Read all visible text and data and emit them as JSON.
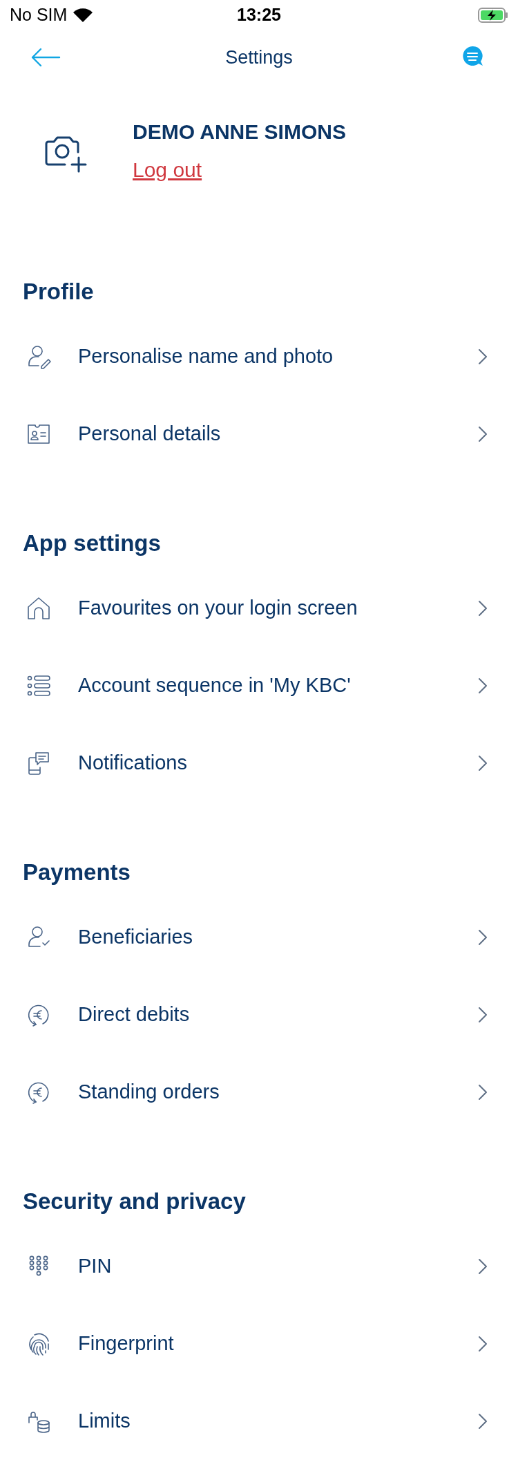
{
  "status_bar": {
    "carrier": "No SIM",
    "time": "13:25"
  },
  "nav": {
    "title": "Settings"
  },
  "profile": {
    "name": "DEMO ANNE SIMONS",
    "logout": "Log out"
  },
  "sections": [
    {
      "title": "Profile",
      "items": [
        {
          "label": "Personalise name and photo"
        },
        {
          "label": "Personal details"
        }
      ]
    },
    {
      "title": "App settings",
      "items": [
        {
          "label": "Favourites on your login screen"
        },
        {
          "label": "Account sequence in 'My KBC'"
        },
        {
          "label": "Notifications"
        }
      ]
    },
    {
      "title": "Payments",
      "items": [
        {
          "label": "Beneficiaries"
        },
        {
          "label": "Direct debits"
        },
        {
          "label": "Standing orders"
        }
      ]
    },
    {
      "title": "Security and privacy",
      "items": [
        {
          "label": "PIN"
        },
        {
          "label": "Fingerprint"
        },
        {
          "label": "Limits"
        }
      ]
    }
  ]
}
